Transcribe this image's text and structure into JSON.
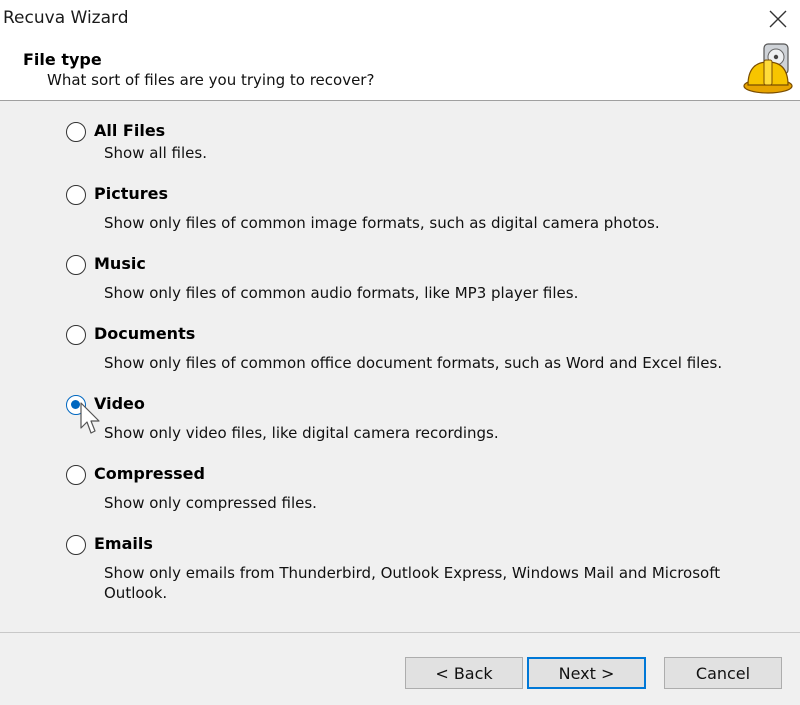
{
  "window": {
    "title": "Recuva Wizard"
  },
  "header": {
    "title": "File type",
    "subtitle": "What sort of files are you trying to recover?"
  },
  "options": [
    {
      "label": "All Files",
      "description": "Show all files.",
      "checked": false
    },
    {
      "label": "Pictures",
      "description": "Show only files of common image formats, such as digital camera photos.",
      "checked": false
    },
    {
      "label": "Music",
      "description": "Show only files of common audio formats, like MP3 player files.",
      "checked": false
    },
    {
      "label": "Documents",
      "description": "Show only files of common office document formats, such as Word and Excel files.",
      "checked": false
    },
    {
      "label": "Video",
      "description": "Show only video files, like digital camera recordings.",
      "checked": true
    },
    {
      "label": "Compressed",
      "description": "Show only compressed files.",
      "checked": false
    },
    {
      "label": "Emails",
      "description": "Show only emails from Thunderbird, Outlook Express, Windows Mail and Microsoft Outlook.",
      "checked": false
    }
  ],
  "buttons": {
    "back": "< Back",
    "next": "Next >",
    "cancel": "Cancel"
  },
  "colors": {
    "accent": "#0067c0",
    "content_bg": "#f0f0f0",
    "button_bg": "#e1e1e1",
    "default_border": "#0078d7"
  },
  "icons": {
    "close": "close-icon",
    "logo": "recuva-logo-icon",
    "cursor": "mouse-pointer-icon"
  }
}
